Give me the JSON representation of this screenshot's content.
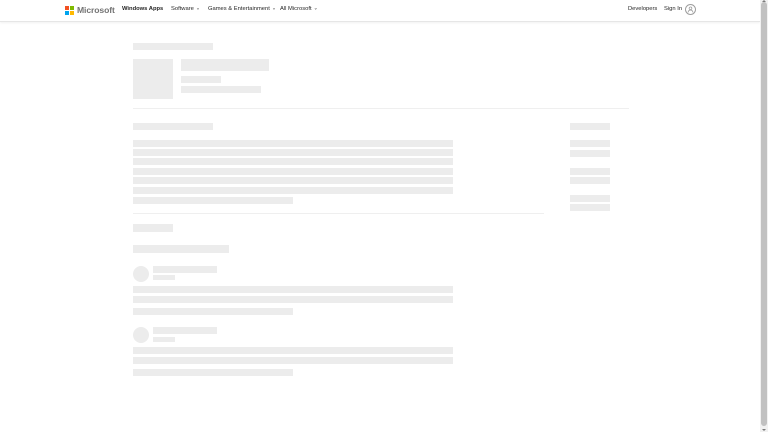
{
  "header": {
    "logo_text": "Microsoft",
    "logo_colors": [
      "#f25022",
      "#7fba00",
      "#00a4ef",
      "#ffb900"
    ],
    "store_title": "Windows Apps",
    "nav": [
      {
        "label": "Software",
        "chevron": "⌄"
      },
      {
        "label": "Games & Entertainment",
        "chevron": "⌄"
      },
      {
        "label": "All Microsoft",
        "chevron": "⌄"
      }
    ],
    "developers": "Developers",
    "sign_in": "Sign In",
    "avatar_icon": "user-icon"
  },
  "colors": {
    "skeleton": "#ececec",
    "divider": "#efefef",
    "header_border": "#e6e6e6"
  },
  "state": "loading-skeleton"
}
